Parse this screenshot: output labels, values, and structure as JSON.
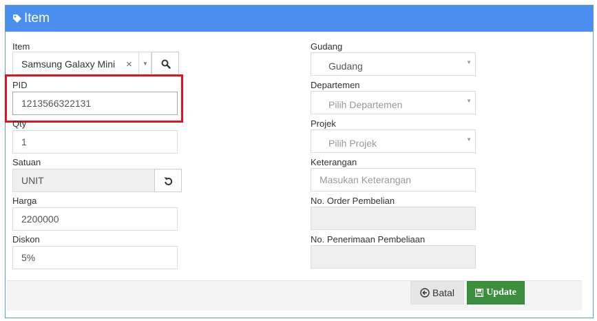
{
  "panel": {
    "title": "Item"
  },
  "left": {
    "item": {
      "label": "Item",
      "value": "Samsung Galaxy Mini",
      "clear": "×",
      "arrow": "▼"
    },
    "pid": {
      "label": "PID",
      "value": "1213566322131"
    },
    "qty": {
      "label": "Qty",
      "value": "1"
    },
    "satuan": {
      "label": "Satuan",
      "value": "UNIT"
    },
    "harga": {
      "label": "Harga",
      "value": "2200000"
    },
    "diskon": {
      "label": "Diskon",
      "value": "5%"
    }
  },
  "right": {
    "gudang": {
      "label": "Gudang",
      "value": "Gudang",
      "arrow": "▼"
    },
    "departemen": {
      "label": "Departemen",
      "placeholder": "Pilih Departemen",
      "arrow": "▼"
    },
    "projek": {
      "label": "Projek",
      "placeholder": "Pilih Projek",
      "arrow": "▼"
    },
    "keterangan": {
      "label": "Keterangan",
      "placeholder": "Masukan Keterangan"
    },
    "order": {
      "label": "No. Order Pembelian",
      "value": ""
    },
    "penerimaan": {
      "label": "No. Penerimaan Pembeliaan",
      "value": ""
    }
  },
  "footer": {
    "batal_label": "Batal",
    "update_label": "Update"
  },
  "colors": {
    "header": "#4a8ff0",
    "update": "#3c8f3c",
    "highlight": "#e0141e"
  },
  "icons": [
    "tag-icon",
    "search-icon",
    "refresh-icon",
    "arrow-left-circle-icon",
    "save-icon"
  ]
}
